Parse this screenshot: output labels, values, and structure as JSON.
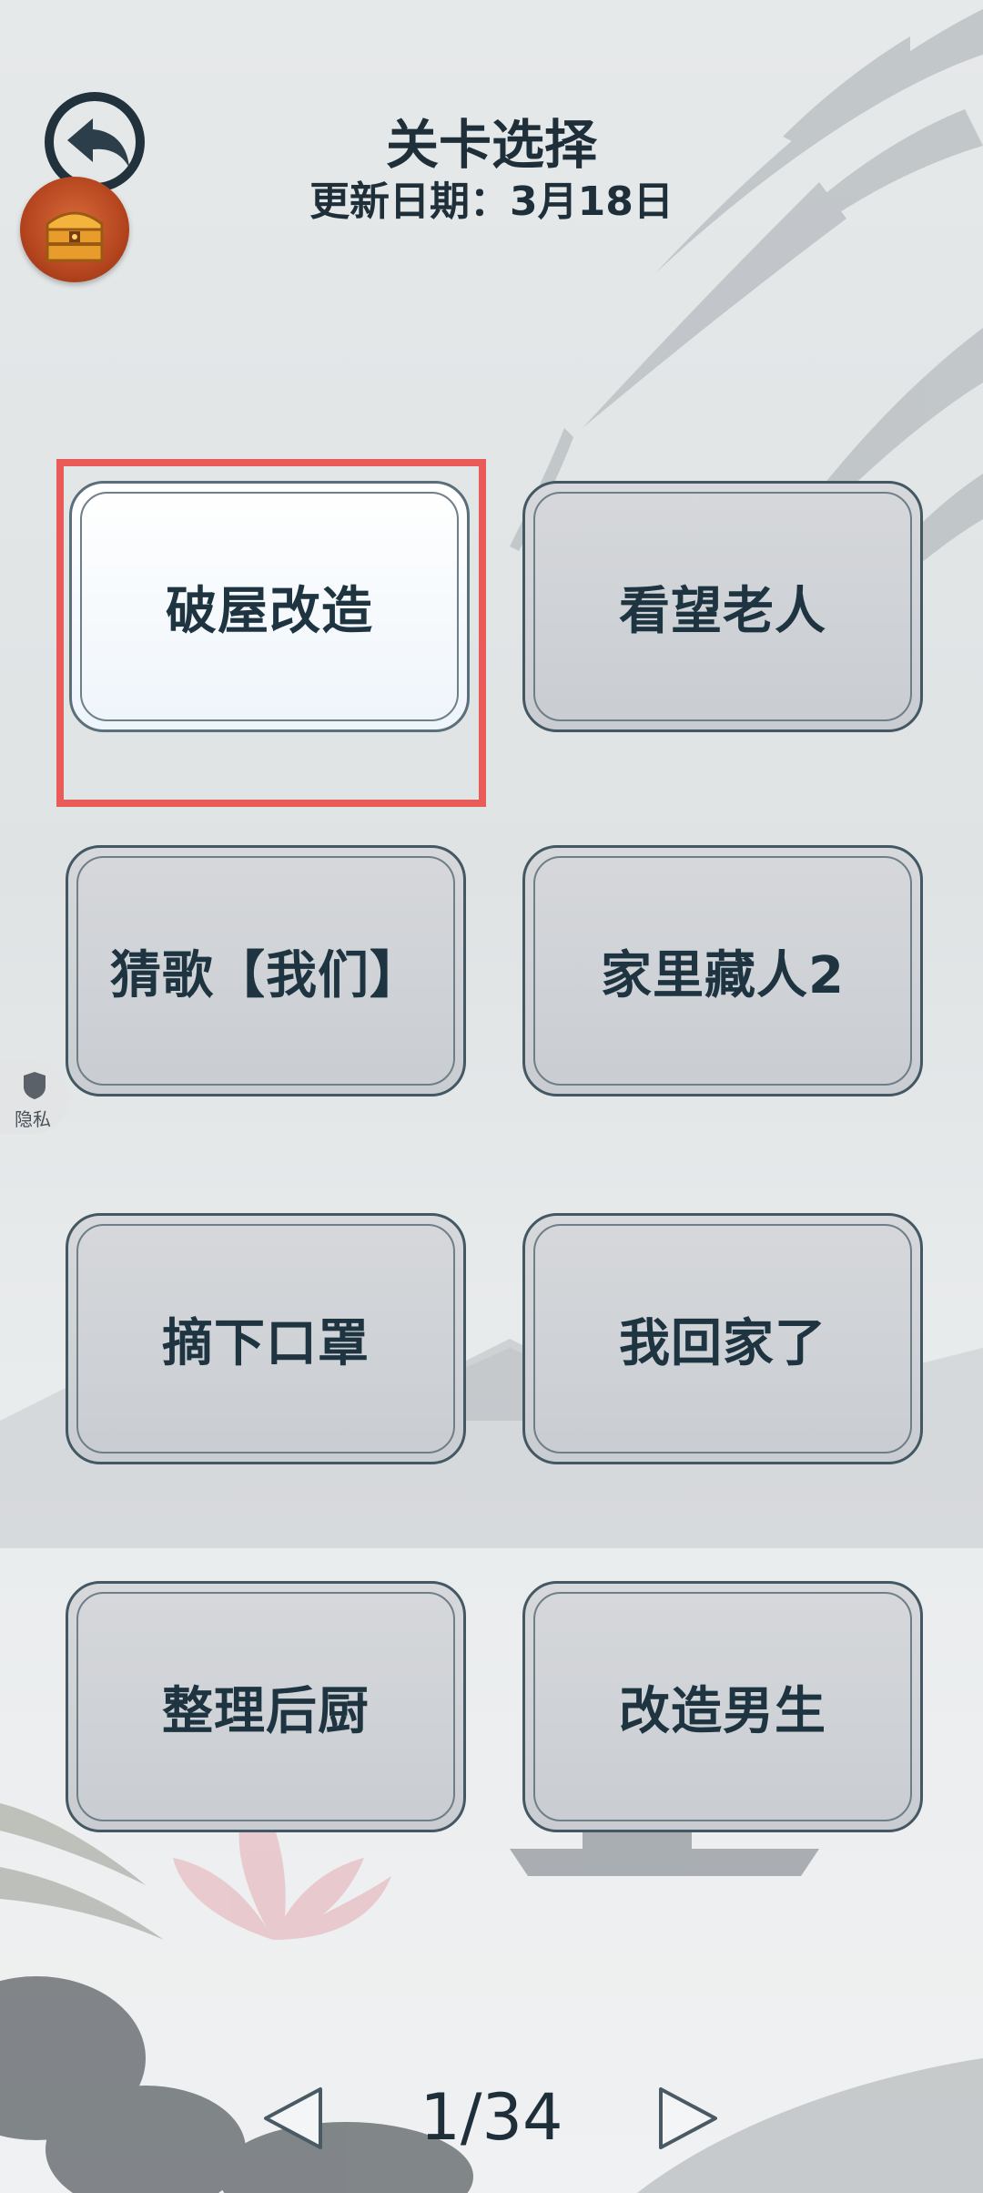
{
  "header": {
    "title": "关卡选择",
    "update": "更新日期：3月18日"
  },
  "levels": [
    {
      "label": "破屋改造",
      "selected": true
    },
    {
      "label": "看望老人"
    },
    {
      "label": "猜歌【我们】"
    },
    {
      "label": "家里藏人2"
    },
    {
      "label": "摘下口罩"
    },
    {
      "label": "我回家了"
    },
    {
      "label": "整理后厨"
    },
    {
      "label": "改造男生"
    }
  ],
  "privacy_label": "隐私",
  "pagination": {
    "page": "1/34"
  },
  "colors": {
    "highlight": "#e85b58",
    "chest": "#b5461f",
    "text": "#1f2f3a"
  }
}
